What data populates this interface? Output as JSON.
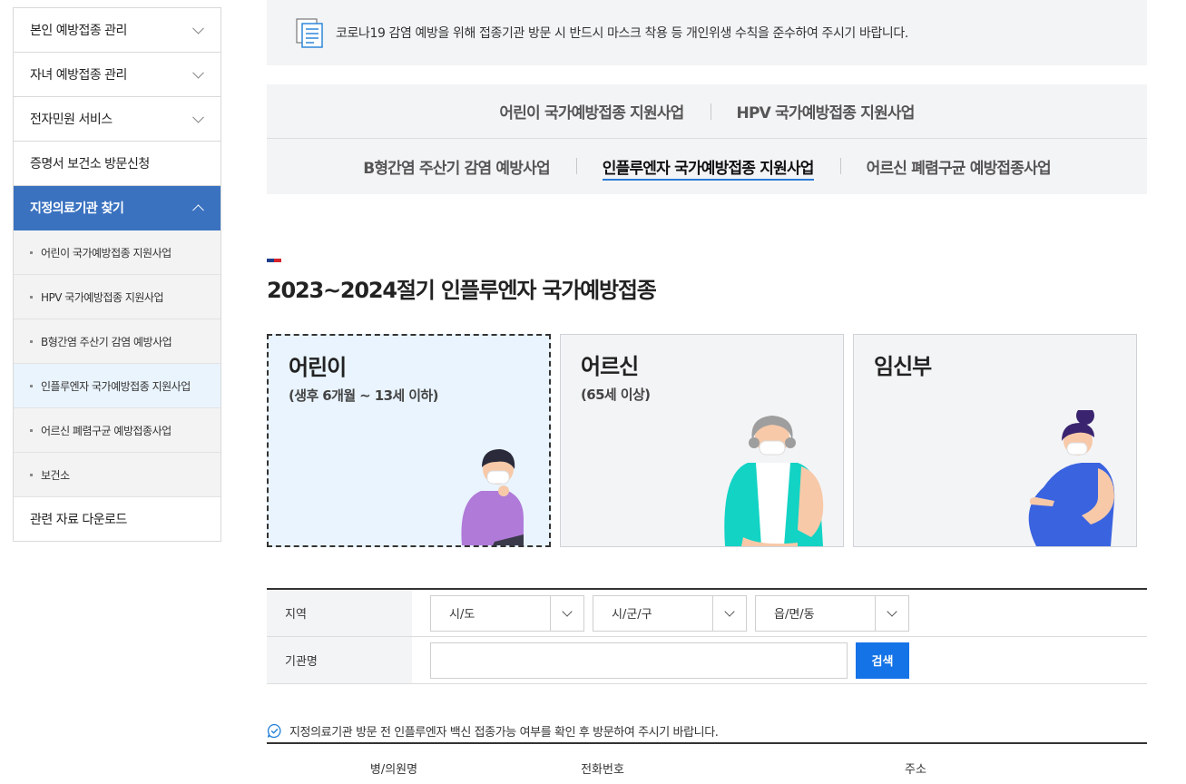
{
  "sidebar": {
    "items": [
      {
        "label": "본인 예방접종 관리"
      },
      {
        "label": "자녀 예방접종 관리"
      },
      {
        "label": "전자민원 서비스"
      },
      {
        "label": "증명서 보건소 방문신청"
      },
      {
        "label": "지정의료기관 찾기"
      }
    ],
    "sub_items": [
      {
        "label": "어린이 국가예방접종 지원사업"
      },
      {
        "label": "HPV 국가예방접종 지원사업"
      },
      {
        "label": "B형간염 주산기 감염 예방사업"
      },
      {
        "label": "인플루엔자 국가예방접종 지원사업"
      },
      {
        "label": "어르신 폐렴구균 예방접종사업"
      },
      {
        "label": "보건소"
      }
    ],
    "download": {
      "label": "관련 자료 다운로드"
    }
  },
  "notice": {
    "text": "코로나19 감염 예방을 위해 접종기관 방문 시 반드시 마스크 착용 등 개인위생 수칙을 준수하여 주시기 바랍니다."
  },
  "tabs": {
    "row1": [
      "어린이 국가예방접종 지원사업",
      "HPV 국가예방접종 지원사업"
    ],
    "row2": [
      "B형간염 주산기 감염 예방사업",
      "인플루엔자 국가예방접종 지원사업",
      "어르신 폐렴구균 예방접종사업"
    ],
    "selected": "인플루엔자 국가예방접종 지원사업"
  },
  "section_title": "2023~2024절기 인플루엔자 국가예방접종",
  "cards": [
    {
      "title": "어린이",
      "sub": "(생후 6개월 ~ 13세 이하)"
    },
    {
      "title": "어르신",
      "sub": "(65세 이상)"
    },
    {
      "title": "임신부",
      "sub": ""
    }
  ],
  "form": {
    "region_label": "지역",
    "selects": [
      "시/도",
      "시/군/구",
      "읍/면/동"
    ],
    "org_label": "기관명",
    "org_placeholder": "",
    "search_label": "검색"
  },
  "info_text": "지정의료기관 방문 전 인플루엔자 백신 접종가능 여부를 확인 후 방문하여 주시기 바랍니다.",
  "results": {
    "columns": [
      "병/의원명",
      "전화번호",
      "주소"
    ]
  },
  "colors": {
    "primary": "#3a72c0",
    "button": "#1473e6",
    "selected_card_bg": "#e9f4fe",
    "panel_bg": "#f3f4f6"
  }
}
